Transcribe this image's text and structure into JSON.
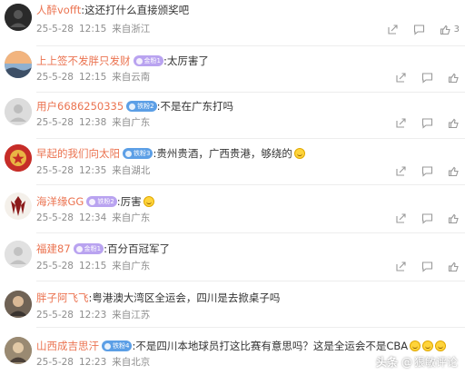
{
  "colors": {
    "username": "#eb7350",
    "meta": "#8e8e8e",
    "badge_purple": "#b9a3f0",
    "badge_blue": "#5c9fe6"
  },
  "comments": [
    {
      "user": "人醉vofft",
      "badge": "",
      "text": ":这还打什么直接颁奖吧",
      "date": "25-5-28",
      "time": "12:15",
      "location": "来自浙江",
      "likes": "3",
      "avatar_icon": "dark-avatar-icon",
      "emoji": false
    },
    {
      "user": "上上签不发胖只发财",
      "badge": "金粉1",
      "text": ":太厉害了",
      "date": "25-5-28",
      "time": "12:15",
      "location": "来自云南",
      "likes": "",
      "avatar_icon": "sunset-avatar-icon",
      "emoji": false
    },
    {
      "user": "用户6686250335",
      "badge": "铁粉2",
      "text": ":不是在广东打吗",
      "date": "25-5-28",
      "time": "12:38",
      "location": "来自广东",
      "likes": "",
      "avatar_icon": "default-avatar-icon",
      "emoji": false
    },
    {
      "user": "早起的我们向太阳",
      "badge": "铁粉3",
      "text": ":贵州贵酒，广西贵港，够绕的",
      "date": "25-5-28",
      "time": "12:35",
      "location": "来自湖北",
      "likes": "",
      "avatar_icon": "star-emblem-avatar-icon",
      "emoji": true
    },
    {
      "user": "海洋缘GG",
      "badge": "铁粉2",
      "text": ":厉害",
      "date": "25-5-28",
      "time": "12:34",
      "location": "来自广东",
      "likes": "",
      "avatar_icon": "emblem-avatar-icon",
      "emoji": true
    },
    {
      "user": "福建87",
      "badge": "金粉1",
      "text": ":百分百冠军了",
      "date": "25-5-28",
      "time": "12:15",
      "location": "来自广东",
      "likes": "",
      "avatar_icon": "default-avatar-icon",
      "emoji": false
    },
    {
      "user": "胖子阿飞飞",
      "badge": "",
      "text": ":粤港澳大湾区全运会，四川是去掀桌子吗",
      "date": "25-5-28",
      "time": "12:23",
      "location": "来自江苏",
      "likes": "",
      "avatar_icon": "photo-avatar-icon",
      "emoji": false
    },
    {
      "user": "山西成吉思汗",
      "badge": "铁粉4",
      "text": ":不是四川本地球员打这比赛有意思吗？这是全运会不是CBA",
      "date": "25-5-28",
      "time": "12:23",
      "location": "来自北京",
      "likes": "",
      "avatar_icon": "photo-avatar-icon",
      "emoji": true
    }
  ],
  "watermark": {
    "platform": "头条",
    "at": "@",
    "account": "狠敏评论"
  }
}
